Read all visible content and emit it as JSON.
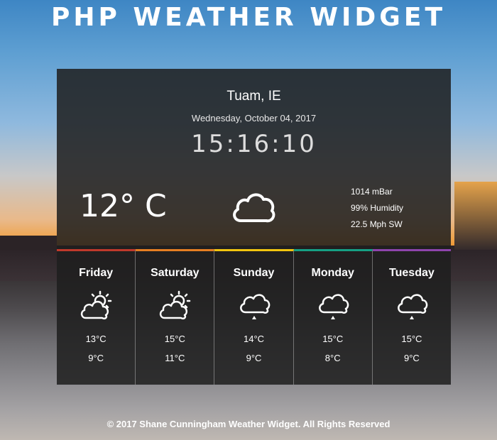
{
  "page": {
    "title": "PHP WEATHER WIDGET",
    "footer": "© 2017 Shane Cunningham Weather Widget. All Rights Reserved"
  },
  "current": {
    "location": "Tuam, IE",
    "date": "Wednesday, October 04, 2017",
    "time": "15:16:10",
    "temperature": "12° C",
    "condition_icon": "cloud-icon",
    "pressure": "1014 mBar",
    "humidity": "99% Humidity",
    "wind": "22.5 Mph SW"
  },
  "forecast": [
    {
      "day": "Friday",
      "high": "13°C",
      "low": "9°C",
      "icon": "partly-cloudy-icon",
      "accent": "#c0392b"
    },
    {
      "day": "Saturday",
      "high": "15°C",
      "low": "11°C",
      "icon": "partly-cloudy-icon",
      "accent": "#e67e22"
    },
    {
      "day": "Sunday",
      "high": "14°C",
      "low": "9°C",
      "icon": "rain-cloud-icon",
      "accent": "#f1c40f"
    },
    {
      "day": "Monday",
      "high": "15°C",
      "low": "8°C",
      "icon": "rain-cloud-icon",
      "accent": "#16a085"
    },
    {
      "day": "Tuesday",
      "high": "15°C",
      "low": "9°C",
      "icon": "rain-cloud-icon",
      "accent": "#8e44ad"
    }
  ]
}
